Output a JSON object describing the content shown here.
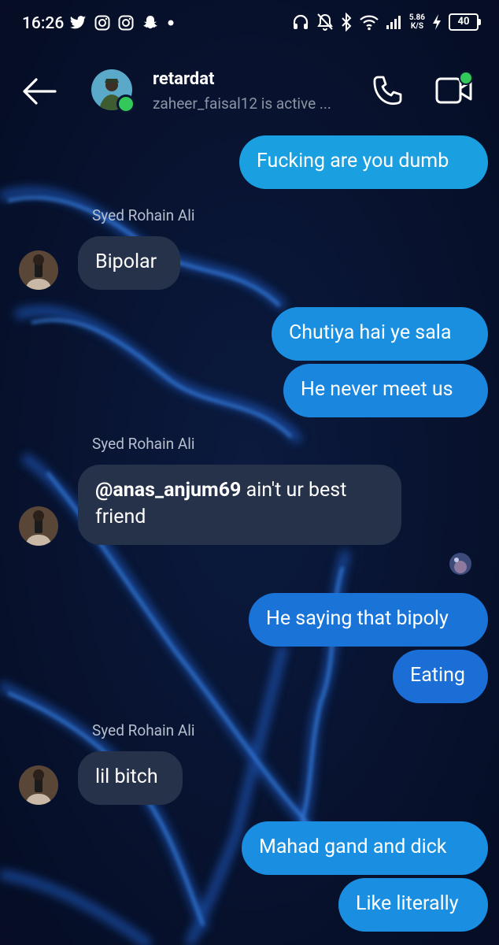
{
  "status_bar": {
    "time": "16:26",
    "net_speed_value": "5.86",
    "net_speed_unit": "K/S",
    "battery": "40"
  },
  "header": {
    "title": "retardat",
    "subtitle": "zaheer_faisal12 is active ..."
  },
  "messages": {
    "m1": "Fucking are you dumb",
    "s1": "Syed Rohain Ali",
    "m2": "Bipolar",
    "m3": "Chutiya hai ye sala",
    "m4": "He never meet us",
    "s2": "Syed Rohain Ali",
    "m5_mention": "@anas_anjum69",
    "m5_rest": " ain't ur best",
    "m5_line2": "friend",
    "m6": "He saying that bipoly",
    "m7": "Eating",
    "s3": "Syed Rohain Ali",
    "m8": "lil bitch",
    "m9": "Mahad gand and dick",
    "m10": "Like literally"
  },
  "colors": {
    "background": "#081431",
    "incoming_bubble": "#26314a",
    "online": "#33c85a"
  }
}
